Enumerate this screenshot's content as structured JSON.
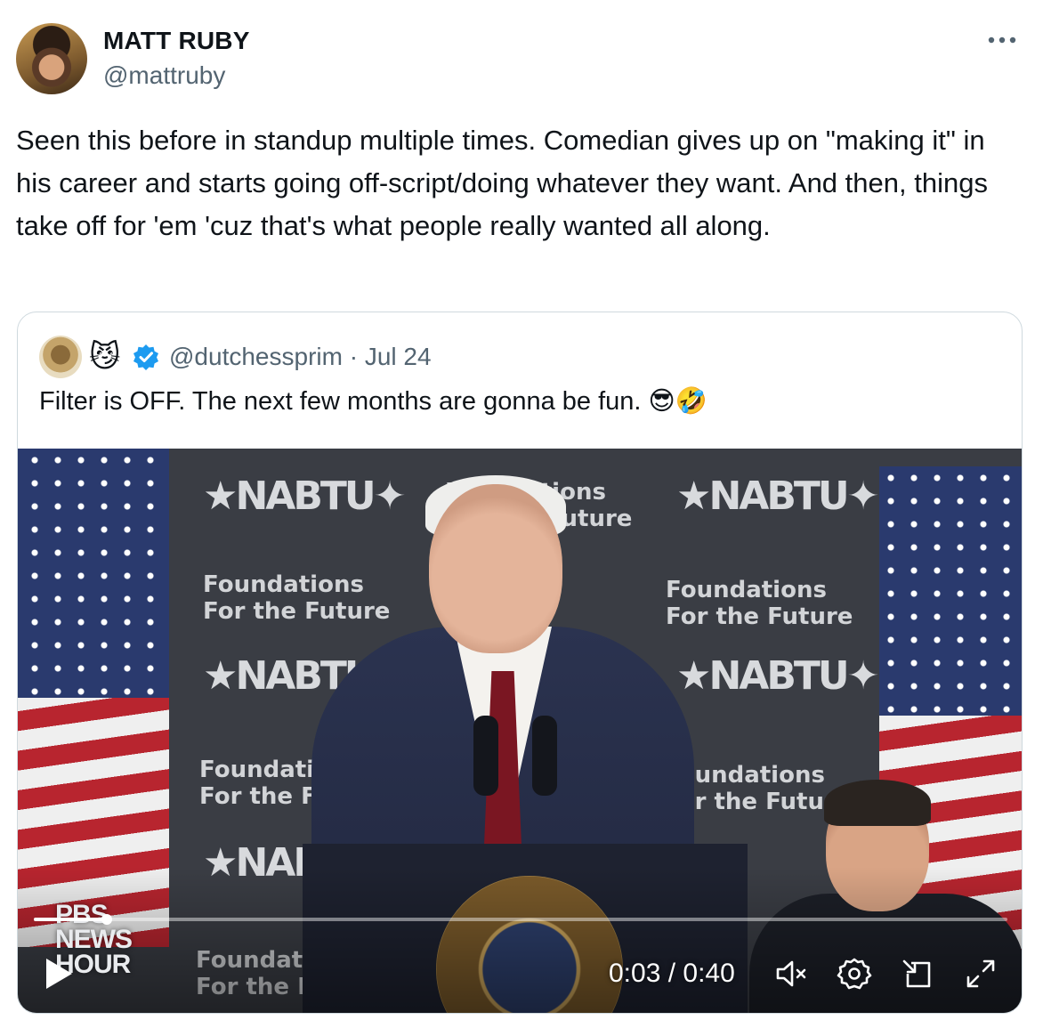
{
  "author": {
    "name": "MATT RUBY",
    "handle": "@mattruby",
    "avatar_icon": "avatar"
  },
  "more_icon": "more-dots-icon",
  "tweet": {
    "text": "Seen this before in standup multiple times. Comedian gives up on \"making it\" in his career and starts going off-script/doing whatever they want. And then, things take off for 'em 'cuz that's what people really wanted all along."
  },
  "quote": {
    "emoji": "😼",
    "verified_icon": "verified-badge-icon",
    "handle_date": "@dutchessprim · Jul 24",
    "text": "Filter is OFF. The next few months are gonna be fun. 😎🤣"
  },
  "video": {
    "backdrop": {
      "logo": "★NABTU✦",
      "tagline_1": "Foundations",
      "tagline_2": "For the Future"
    },
    "watermark": "PBS NEWS HOUR",
    "time": "0:03 / 0:40",
    "progress_fraction": 0.075,
    "controls": {
      "play": "play-icon",
      "mute": "muted-speaker-icon",
      "settings": "gear-icon",
      "pip": "picture-in-picture-icon",
      "fullscreen": "fullscreen-icon"
    }
  },
  "colors": {
    "text": "#0f1419",
    "secondary": "#536471",
    "border": "#cfd9de",
    "verified": "#1d9bf0"
  }
}
